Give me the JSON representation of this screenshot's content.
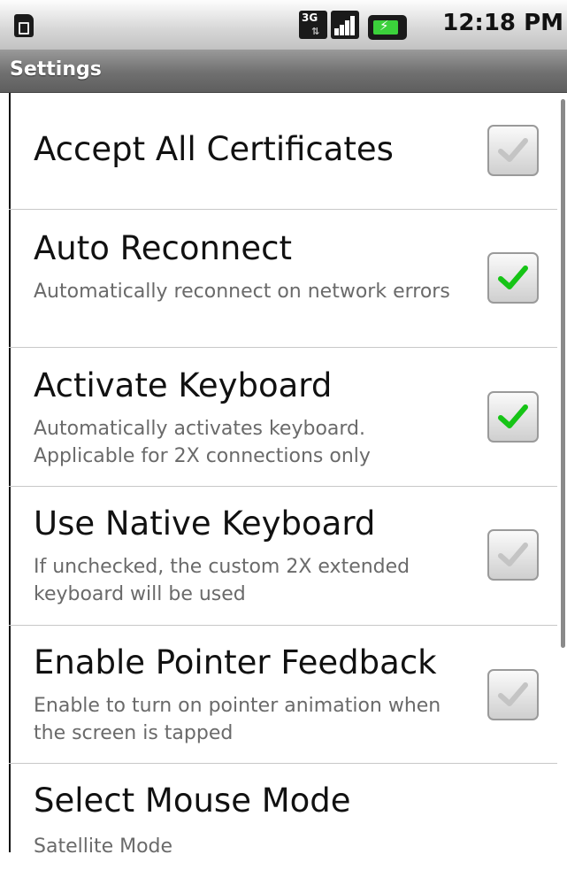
{
  "status_bar": {
    "network_type": "3G",
    "time": "12:18 PM",
    "icons": [
      "sim-card-icon",
      "3g-data-icon",
      "signal-strength-icon",
      "battery-charging-icon"
    ],
    "battery_color": "#3bd13b"
  },
  "title_bar": {
    "title": "Settings"
  },
  "settings": [
    {
      "title": "Accept All Certificates",
      "summary": "",
      "checked": false
    },
    {
      "title": "Auto Reconnect",
      "summary": "Automatically reconnect on network errors",
      "checked": true
    },
    {
      "title": "Activate Keyboard",
      "summary": "Automatically activates keyboard. Applicable for 2X connections only",
      "checked": true
    },
    {
      "title": "Use Native Keyboard",
      "summary": "If unchecked, the custom 2X extended keyboard will be used",
      "checked": false
    },
    {
      "title": "Enable Pointer Feedback",
      "summary": "Enable to turn on pointer animation when the screen is tapped",
      "checked": false
    },
    {
      "title": "Select Mouse Mode",
      "summary": "Satellite Mode"
    }
  ],
  "colors": {
    "check_on": "#16c416",
    "check_off": "#c4c4c4"
  }
}
